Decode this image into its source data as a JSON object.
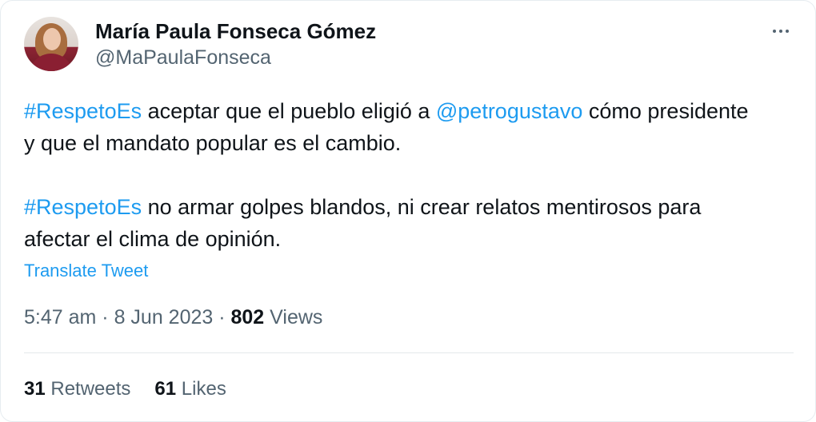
{
  "author": {
    "display_name": "María Paula Fonseca Gómez",
    "handle": "@MaPaulaFonseca",
    "avatar_icon": "profile-photo"
  },
  "menu": {
    "icon": "more-horizontal-icon"
  },
  "tweet": {
    "paragraph1": {
      "hashtag": "#RespetoEs",
      "text1": " aceptar que el pueblo eligió a ",
      "mention": "@petrogustavo",
      "text2": " cómo presidente",
      "line2": "y que el mandato popular es el cambio."
    },
    "paragraph2": {
      "hashtag": "#RespetoEs",
      "text1": " no armar golpes blandos, ni crear relatos mentirosos para",
      "line2": "afectar el clima de opinión."
    },
    "translate_label": "Translate Tweet"
  },
  "meta": {
    "time": "5:47 am",
    "sep1": " · ",
    "date": "8 Jun 2023",
    "sep2": " · ",
    "views_count": "802",
    "views_label": " Views"
  },
  "stats": {
    "retweets_count": "31",
    "retweets_label": " Retweets",
    "likes_count": "61",
    "likes_label": " Likes"
  },
  "colors": {
    "link": "#1d9bf0",
    "secondary_text": "#536471",
    "primary_text": "#0f1419",
    "divider": "#e3e8eb"
  }
}
